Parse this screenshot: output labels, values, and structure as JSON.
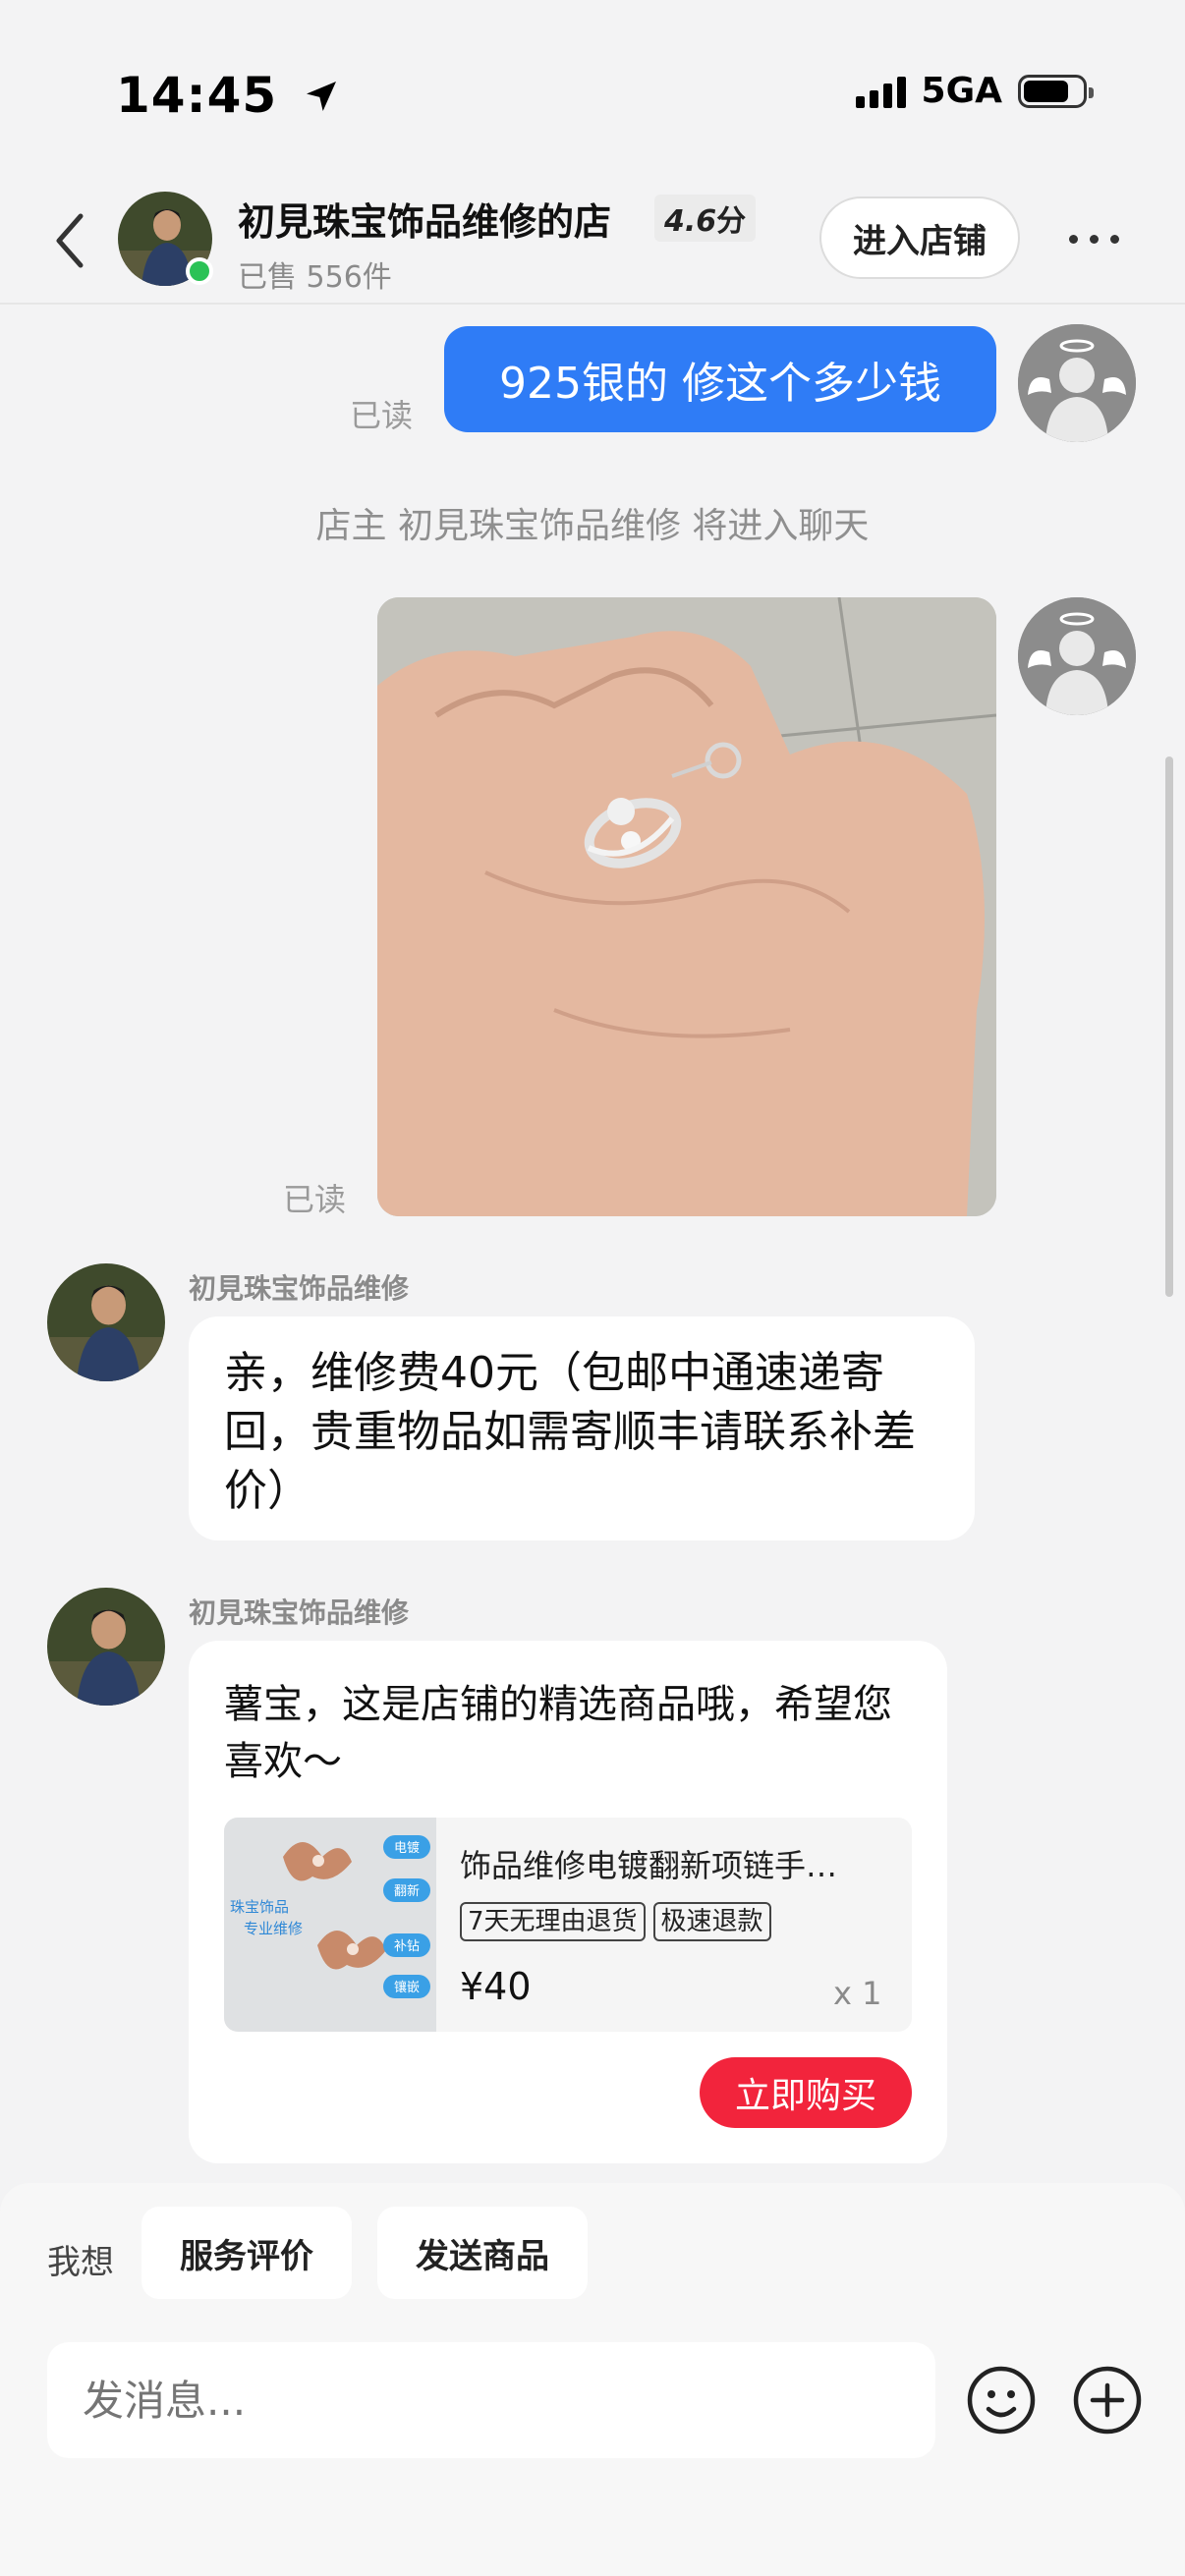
{
  "status_bar": {
    "time": "14:45",
    "network": "5GA"
  },
  "header": {
    "shop_name": "初見珠宝饰品维修的店",
    "rating": "4.6",
    "rating_unit": "分",
    "sold": "已售 556件",
    "enter_shop_label": "进入店铺"
  },
  "messages": {
    "my_text": "925银的 修这个多少钱",
    "read_label": "已读",
    "system_notice": "店主 初見珠宝饰品维修 将进入聊天",
    "sender_name": "初見珠宝饰品维修",
    "shop_reply_1": "亲，维修费40元（包邮中通速递寄回，贵重物品如需寄顺丰请联系补差价）",
    "shop_reply_2": "薯宝，这是店铺的精选商品哦，希望您喜欢～",
    "product": {
      "title": "饰品维修电镀翻新项链手…",
      "tags": [
        "7天无理由退货",
        "极速退款"
      ],
      "price": "¥40",
      "qty": "x 1",
      "thumb_labels": [
        "电镀",
        "翻新",
        "补钻",
        "镶嵌"
      ],
      "thumb_side_text": [
        "珠宝饰品",
        "专业维修"
      ]
    },
    "buy_label": "立即购买"
  },
  "bottom": {
    "want_label": "我想",
    "quick_actions": [
      "服务评价",
      "发送商品"
    ],
    "input_placeholder": "发消息..."
  },
  "colors": {
    "my_bubble": "#2f7cf6",
    "buy_button": "#f2243c",
    "online": "#2bc256"
  },
  "icons": [
    "location-arrow-icon",
    "signal-icon",
    "battery-icon",
    "back-icon",
    "more-icon",
    "emoji-icon",
    "plus-icon"
  ]
}
